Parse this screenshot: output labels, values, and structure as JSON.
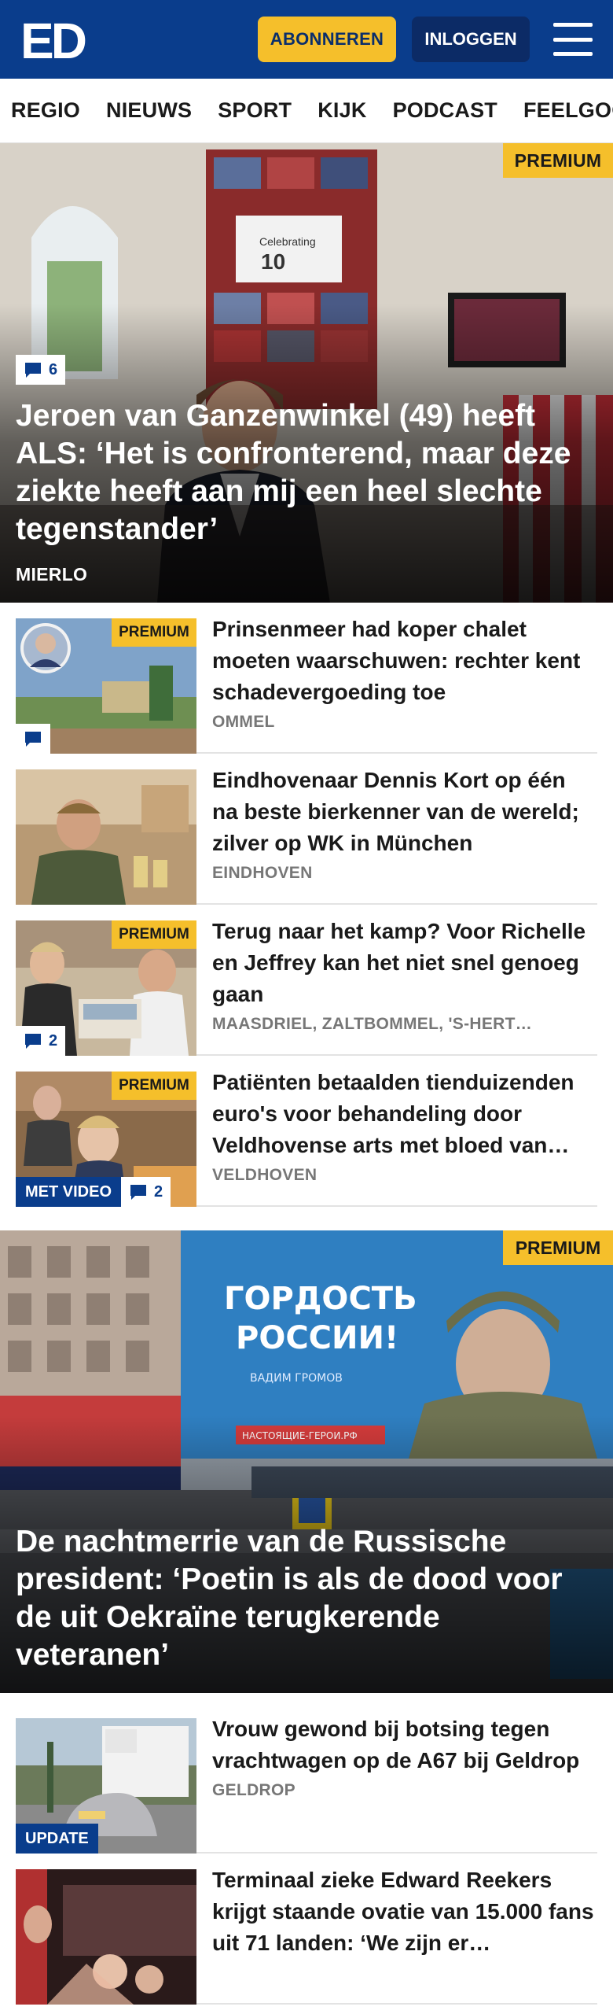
{
  "header": {
    "logo_text": "ED",
    "subscribe_label": "ABONNEREN",
    "login_label": "INLOGGEN",
    "menu_icon": "hamburger-menu-icon"
  },
  "nav": {
    "items": [
      "REGIO",
      "NIEUWS",
      "SPORT",
      "KIJK",
      "PODCAST",
      "FEELGOOD"
    ]
  },
  "colors": {
    "brand_blue": "#0a3d8c",
    "accent_yellow": "#f5bf2b",
    "meta_grey": "#777777"
  },
  "hero": {
    "badge": "PREMIUM",
    "comments": "6",
    "title": "Jeroen van Ganzenwinkel (49) heeft ALS: ‘Het is confronterend, maar deze ziekte heeft aan mij een heel slechte tegenstander’",
    "location": "MIERLO"
  },
  "articles": [
    {
      "badge": "PREMIUM",
      "comments": "",
      "title": "Prinsenmeer had koper chalet moeten waarschuwen: rechter kent schadevergoeding toe",
      "location": "OMMEL"
    },
    {
      "badge": "",
      "comments": "",
      "title": "Eindhovenaar Dennis Kort op één na beste bierkenner van de wereld; zilver op WK in München",
      "location": "EINDHOVEN"
    },
    {
      "badge": "PREMIUM",
      "comments": "2",
      "title": "Terug naar het kamp? Voor Richelle en Jeffrey kan het niet snel genoeg gaan",
      "location": "MAASDRIEL, ZALTBOMMEL, 'S-HERT…"
    },
    {
      "badge": "PREMIUM",
      "video": "MET VIDEO",
      "comments": "2",
      "title": "Patiënten betaalden tienduizen­den euro's voor behandeling door Veldhovense arts met bloed van…",
      "location": "VELDHOVEN"
    }
  ],
  "hero2": {
    "badge": "PREMIUM",
    "title": "De nachtmerrie van de Russische president: ‘Poetin is als de dood voor de uit Oekraïne terugkerende veteranen’",
    "billboard_line1": "ГОРДОСТЬ",
    "billboard_line2": "РОССИИ!",
    "billboard_name": "ВАДИМ ГРОМОВ",
    "billboard_site": "НАСТОЯЩИЕ-ГЕРОИ.РФ"
  },
  "articles2": [
    {
      "update": "UPDATE",
      "title": "Vrouw gewond bij botsing tegen vrachtwagen op de A67 bij Geldrop",
      "location": "GELDROP"
    },
    {
      "title": "Terminaal zieke Edward Reekers krijgt staande ovatie van 15.000 fans uit 71 landen: ‘We zijn er…",
      "location": ""
    }
  ]
}
